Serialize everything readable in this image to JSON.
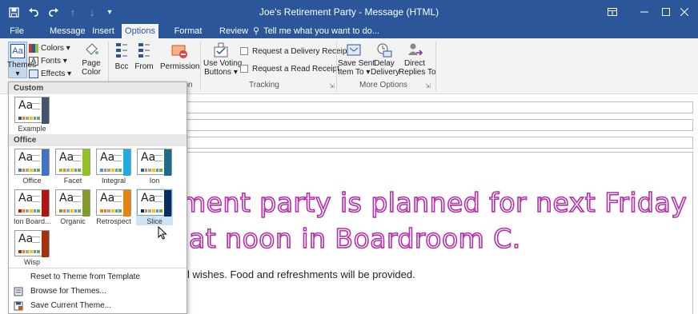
{
  "window": {
    "title": "Joe's Retirement Party - Message (HTML)",
    "controls": [
      "ribbon-display-options-icon",
      "minimize-icon",
      "maximize-icon",
      "close-icon"
    ]
  },
  "quick_access": [
    "save-icon",
    "undo-icon",
    "redo-icon",
    "up-arrow-icon",
    "down-arrow-icon",
    "customize-qat-icon"
  ],
  "menu": {
    "tabs": [
      "File",
      "Message",
      "Insert",
      "Options",
      "Format Text",
      "Review"
    ],
    "active_tab": "Options",
    "tell_me": "Tell me what you want to do..."
  },
  "ribbon": {
    "themes": {
      "themes": "Themes",
      "colors": "Colors",
      "fonts": "Fonts",
      "effects": "Effects",
      "page_color_1": "Page",
      "page_color_2": "Color"
    },
    "show_fields": {
      "bcc": "Bcc",
      "from": "From"
    },
    "permission": {
      "label": "Permission",
      "group_partial": "on"
    },
    "tracking": {
      "use_voting_1": "Use Voting",
      "use_voting_2": "Buttons",
      "delivery_receipt": "Request a Delivery Receipt",
      "read_receipt": "Request a Read Receipt",
      "group": "Tracking"
    },
    "more_options": {
      "save_sent_1": "Save Sent",
      "save_sent_2": "Item To",
      "delay_1": "Delay",
      "delay_2": "Delivery",
      "direct_1": "Direct",
      "direct_2": "Replies To",
      "group": "More Options"
    }
  },
  "themes_dropdown": {
    "sections": {
      "custom": "Custom",
      "office": "Office"
    },
    "custom_themes": [
      {
        "name": "Example",
        "accent": "#44546a"
      }
    ],
    "office_themes": [
      {
        "name": "Office",
        "accent": "#4472c4"
      },
      {
        "name": "Facet",
        "accent": "#90c226"
      },
      {
        "name": "Integral",
        "accent": "#1cade4"
      },
      {
        "name": "Ion",
        "accent": "#1d6a8a"
      },
      {
        "name": "Ion Board...",
        "accent": "#b01513"
      },
      {
        "name": "Organic",
        "accent": "#83992a"
      },
      {
        "name": "Retrospect",
        "accent": "#e48312"
      },
      {
        "name": "Slice",
        "accent": "#052f61"
      },
      {
        "name": "Wisp",
        "accent": "#a53010"
      }
    ],
    "selected": "Slice",
    "actions": {
      "reset": "Reset to Theme from Template",
      "browse": "Browse for Themes...",
      "save": "Save Current Theme..."
    }
  },
  "message": {
    "heading_line1": "ment party is planned for next Friday",
    "heading_line2": "at noon in Boardroom C.",
    "body": "l wishes. Food and refreshments will be provided.",
    "heading_color": "#b42fa9"
  }
}
